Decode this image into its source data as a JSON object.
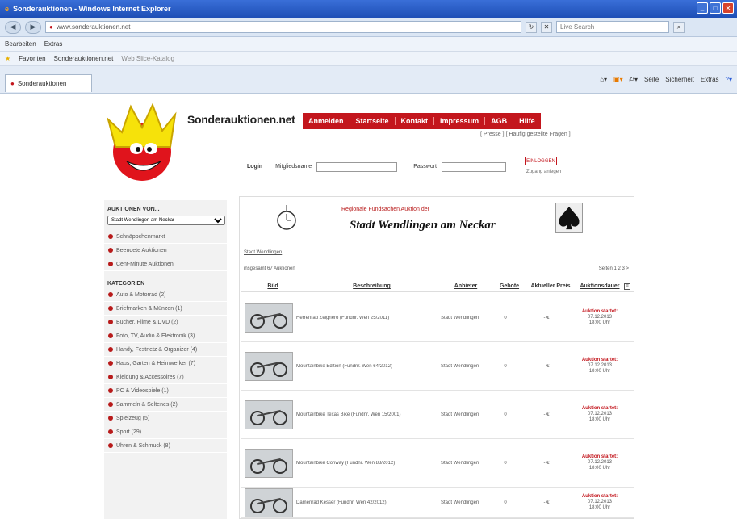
{
  "browser": {
    "title": "Sonderauktionen - Windows Internet Explorer",
    "url_host": "www.sonderauktionen.net",
    "url_domain_bold": "sonderauktionen.net",
    "search_placeholder": "Live Search",
    "menu": [
      "Bearbeiten",
      "Extras"
    ],
    "favorites_label": "Favoriten",
    "fav_items": [
      "Sonderauktionen.net",
      "Web Slice-Katalog"
    ],
    "tab_label": "Sonderauktionen",
    "commands": [
      "Seite",
      "Sicherheit",
      "Extras"
    ]
  },
  "site": {
    "name": "Sonderauktionen.net",
    "nav": [
      "Anmelden",
      "Startseite",
      "Kontakt",
      "Impressum",
      "AGB",
      "Hilfe"
    ],
    "sublinks": "[ Presse ] [ Häufig gestellte Fragen ]",
    "login": {
      "label": "Login",
      "member_label": "Mitgliedsname",
      "password_label": "Passwort",
      "button": "EINLOGGEN",
      "register": "Zugang anlegen"
    }
  },
  "sidebar": {
    "heading1": "AUKTIONEN VON...",
    "select_value": "Stadt Wendlingen am Neckar",
    "quick_items": [
      "Schnäppchenmarkt",
      "Beendete Auktionen",
      "Cent-Minute Auktionen"
    ],
    "heading2": "KATEGORIEN",
    "categories": [
      "Auto & Motorrad (2)",
      "Briefmarken & Münzen (1)",
      "Bücher, Filme & DVD (2)",
      "Foto, TV, Audio & Elektronik (3)",
      "Handy, Festnetz & Organizer (4)",
      "Haus, Garten & Heimwerker (7)",
      "Kleidung & Accessoires (7)",
      "PC & Videospiele (1)",
      "Sammeln & Seltenes (2)",
      "Spielzeug (5)",
      "Sport (29)",
      "Uhren & Schmuck (8)"
    ]
  },
  "banner": {
    "line1": "Regionale Fundsachen Auktion der",
    "line2": "Stadt Wendlingen am Neckar"
  },
  "listing": {
    "breadcrumb": "Stadt Wendlingen",
    "count": "insgesamt 67 Auktionen",
    "paging": "Seiten 1 2 3 >",
    "headers": {
      "image": "Bild",
      "description": "Beschreibung",
      "seller": "Anbieter",
      "bids": "Gebote",
      "price": "Aktueller Preis",
      "duration": "Auktionsdauer"
    },
    "rows": [
      {
        "desc": "Herrenrad Zeighero (Fundnr. Wen 25/2011)",
        "seller": "Stadt Wendlingen",
        "bids": "0",
        "price": "- €",
        "status": "Auktion startet:",
        "date": "07.12.2013",
        "time": "18:00 Uhr"
      },
      {
        "desc": "Mountainbike Edition (Fundnr. Wen 64/2012)",
        "seller": "Stadt Wendlingen",
        "bids": "0",
        "price": "- €",
        "status": "Auktion startet:",
        "date": "07.12.2013",
        "time": "18:00 Uhr"
      },
      {
        "desc": "Mountainbike Texas Bike (Fundnr. Wen 15/2001)",
        "seller": "Stadt Wendlingen",
        "bids": "0",
        "price": "- €",
        "status": "Auktion startet:",
        "date": "07.12.2013",
        "time": "18:00 Uhr"
      },
      {
        "desc": "Mountainbike Conway (Fundnr. Wen 88/2012)",
        "seller": "Stadt Wendlingen",
        "bids": "0",
        "price": "- €",
        "status": "Auktion startet:",
        "date": "07.12.2013",
        "time": "18:00 Uhr"
      },
      {
        "desc": "Damenrad Kesser (Fundnr. Wen 42/2012)",
        "seller": "Stadt Wendlingen",
        "bids": "0",
        "price": "- €",
        "status": "Auktion startet:",
        "date": "07.12.2013",
        "time": "18:00 Uhr"
      }
    ]
  },
  "colors": {
    "brand_red": "#c3161d",
    "sidebar_bg": "#f2f2f2",
    "titlebar": "#1d4eb5"
  }
}
